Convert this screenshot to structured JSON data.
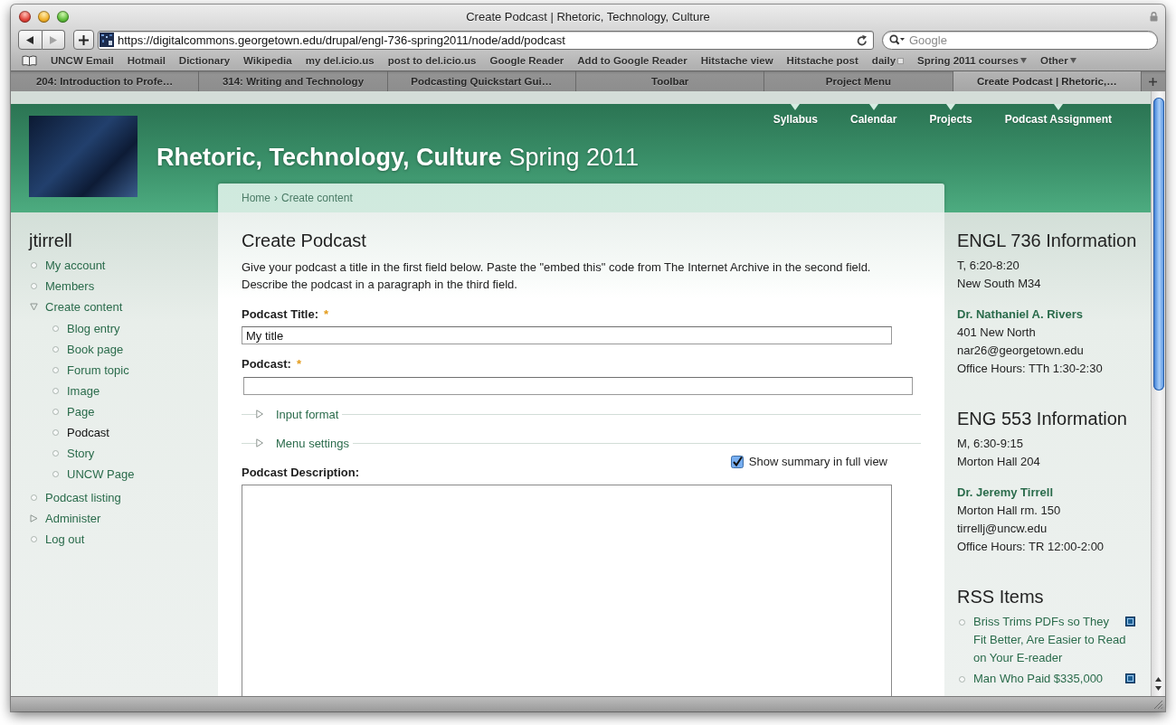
{
  "window": {
    "title": "Create Podcast | Rhetoric, Technology, Culture"
  },
  "toolbar": {
    "back": {
      "disabled": false
    },
    "forward": {
      "disabled": true
    },
    "url": "https://digitalcommons.georgetown.edu/drupal/engl-736-spring2011/node/add/podcast",
    "search": {
      "placeholder": "Google"
    }
  },
  "bookmarks": [
    {
      "label": "UNCW Email",
      "kind": "link"
    },
    {
      "label": "Hotmail",
      "kind": "link"
    },
    {
      "label": "Dictionary",
      "kind": "link"
    },
    {
      "label": "Wikipedia",
      "kind": "link"
    },
    {
      "label": "my del.icio.us",
      "kind": "link"
    },
    {
      "label": "post to del.icio.us",
      "kind": "link"
    },
    {
      "label": "Google Reader",
      "kind": "link"
    },
    {
      "label": "Add to Google Reader",
      "kind": "link"
    },
    {
      "label": "Hitstache view",
      "kind": "link"
    },
    {
      "label": "Hitstache post",
      "kind": "link"
    },
    {
      "label": "daily",
      "kind": "tab_group"
    },
    {
      "label": "Spring 2011 courses",
      "kind": "folder"
    },
    {
      "label": "Other",
      "kind": "folder"
    }
  ],
  "tabs": [
    {
      "label": "204: Introduction to Profe…",
      "selected": false
    },
    {
      "label": "314: Writing and Technology",
      "selected": false
    },
    {
      "label": "Podcasting Quickstart Gui…",
      "selected": false
    },
    {
      "label": "Toolbar",
      "selected": false
    },
    {
      "label": "Project Menu",
      "selected": false
    },
    {
      "label": "Create Podcast | Rhetoric,…",
      "selected": true
    }
  ],
  "header": {
    "site_name": "Rhetoric, Technology, Culture",
    "slogan": "Spring 2011",
    "nav": [
      "Syllabus",
      "Calendar",
      "Projects",
      "Podcast Assignment"
    ],
    "breadcrumb": {
      "links": [
        "Home",
        "Create content"
      ],
      "separator": "›"
    }
  },
  "sidebar": {
    "user": "jtirrell",
    "menu": [
      {
        "label": "My account",
        "kind": "leaf",
        "selected": false
      },
      {
        "label": "Members",
        "kind": "leaf",
        "selected": false
      },
      {
        "label": "Create content",
        "kind": "branch",
        "expanded": true,
        "selected": false,
        "children": [
          {
            "label": "Blog entry",
            "kind": "leaf",
            "selected": false
          },
          {
            "label": "Book page",
            "kind": "leaf",
            "selected": false
          },
          {
            "label": "Forum topic",
            "kind": "leaf",
            "selected": false
          },
          {
            "label": "Image",
            "kind": "leaf",
            "selected": false
          },
          {
            "label": "Page",
            "kind": "leaf",
            "selected": false
          },
          {
            "label": "Podcast",
            "kind": "leaf",
            "selected": true
          },
          {
            "label": "Story",
            "kind": "leaf",
            "selected": false
          },
          {
            "label": "UNCW Page",
            "kind": "leaf",
            "selected": false
          }
        ]
      },
      {
        "label": "Podcast listing",
        "kind": "leaf",
        "selected": false
      },
      {
        "label": "Administer",
        "kind": "branch",
        "expanded": false,
        "selected": false
      },
      {
        "label": "Log out",
        "kind": "leaf",
        "selected": false
      }
    ]
  },
  "main": {
    "title": "Create Podcast",
    "intro": "Give your podcast a title in the first field below. Paste the \"embed this\" code from The Internet Archive in the second field. Describe the podcast in a paragraph in the third field.",
    "required_mark": "*",
    "fields": [
      {
        "kind": "text",
        "label": "Podcast Title:",
        "required": true,
        "value": "My title"
      },
      {
        "kind": "text",
        "label": "Podcast:",
        "required": true
      },
      {
        "kind": "fieldset",
        "label": "Input format",
        "expanded": false
      },
      {
        "kind": "fieldset",
        "label": "Menu settings",
        "expanded": false
      },
      {
        "kind": "textarea",
        "label": "Podcast Description:",
        "required": false,
        "summary_option": {
          "label": "Show summary in full view",
          "checked": true
        }
      }
    ]
  },
  "info": {
    "blocks": [
      {
        "heading": "ENGL 736 Information",
        "schedule": [
          "T, 6:20-8:20",
          "New South M34"
        ],
        "instructor": "Dr. Nathaniel A. Rivers",
        "contact": [
          "401 New North",
          "nar26@georgetown.edu",
          "Office Hours: TTh 1:30-2:30"
        ]
      },
      {
        "heading": "ENG 553 Information",
        "schedule": [
          "M, 6:30-9:15",
          "Morton Hall 204"
        ],
        "instructor": "Dr. Jeremy Tirrell",
        "contact": [
          "Morton Hall rm. 150",
          "tirrellj@uncw.edu",
          "Office Hours: TR 12:00-2:00"
        ]
      }
    ],
    "rss": {
      "heading": "RSS Items",
      "items": [
        "Briss Trims PDFs so They Fit Better, Are Easier to Read on Your E-reader",
        "Man Who Paid $335,000"
      ]
    }
  }
}
